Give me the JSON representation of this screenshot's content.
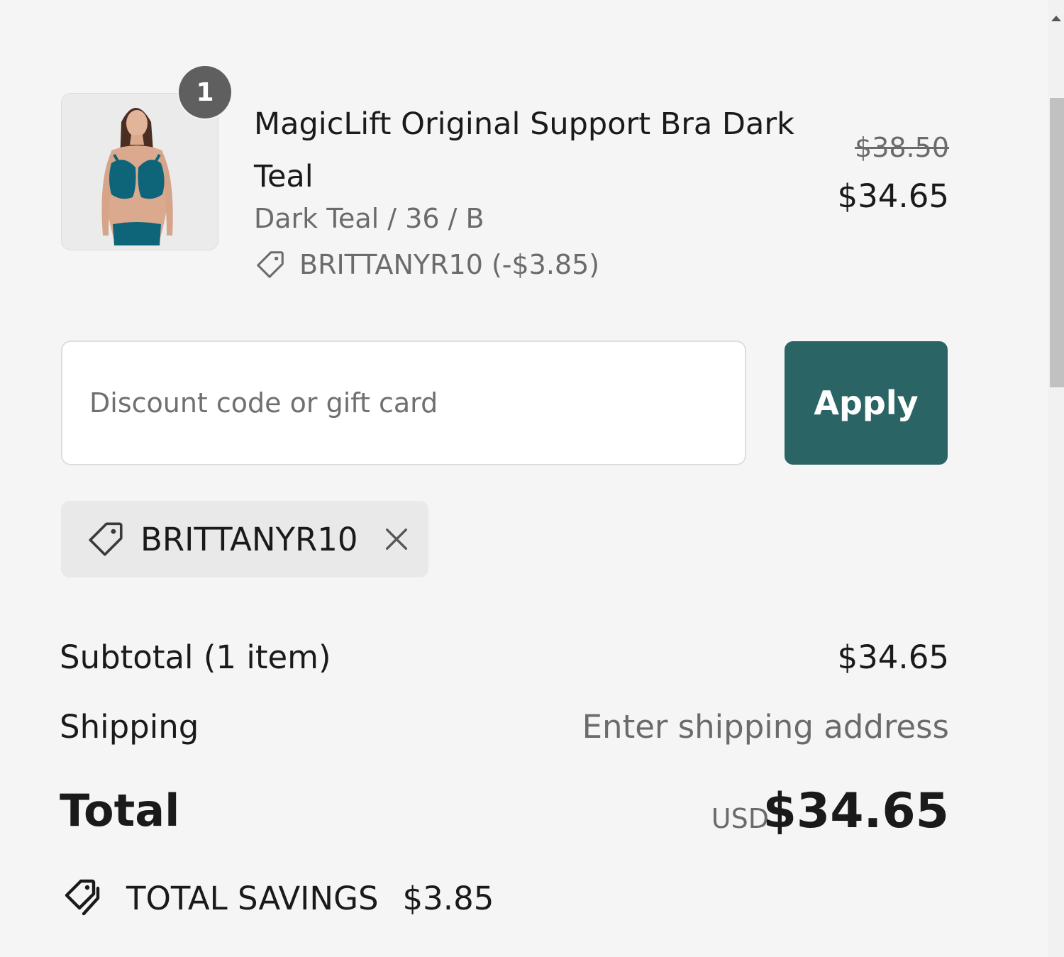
{
  "line_item": {
    "quantity": "1",
    "title": "MagicLift Original Support Bra Dark Teal",
    "variant": "Dark Teal / 36 / B",
    "discount": "BRITTANYR10 (-$3.85)",
    "compare_at_price": "$38.50",
    "price": "$34.65",
    "image_icon": "product-photo-teal-bra"
  },
  "discount_form": {
    "placeholder": "Discount code or gift card",
    "value": "",
    "apply_label": "Apply"
  },
  "applied_codes": [
    {
      "code": "BRITTANYR10"
    }
  ],
  "summary": {
    "subtotal_label": "Subtotal (1 item)",
    "subtotal_value": "$34.65",
    "shipping_label": "Shipping",
    "shipping_value": "Enter shipping address",
    "total_label": "Total",
    "currency": "USD",
    "total_value": "$34.65",
    "savings_label": "TOTAL SAVINGS",
    "savings_value": "$3.85"
  },
  "colors": {
    "accent": "#2a6464",
    "badge": "#5f5f5f",
    "background": "#f5f5f5",
    "muted_text": "#6b6b6b"
  }
}
